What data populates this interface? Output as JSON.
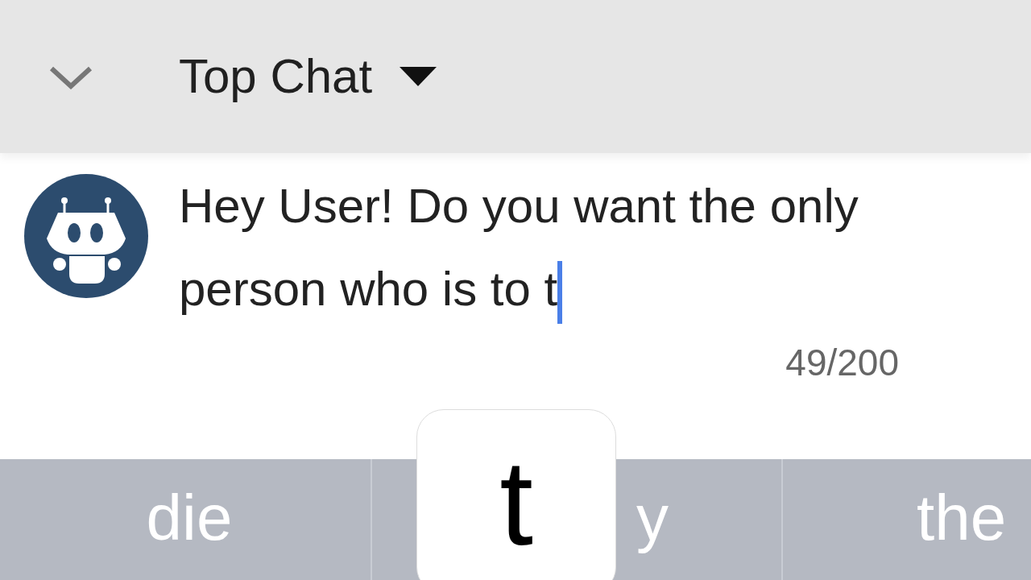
{
  "header": {
    "title": "Top Chat"
  },
  "message": {
    "value": "Hey User! Do you want the only person who is to t",
    "counter": "49/200"
  },
  "suggestions": [
    "die",
    "y",
    "the"
  ],
  "key_popup": {
    "label": "t"
  }
}
